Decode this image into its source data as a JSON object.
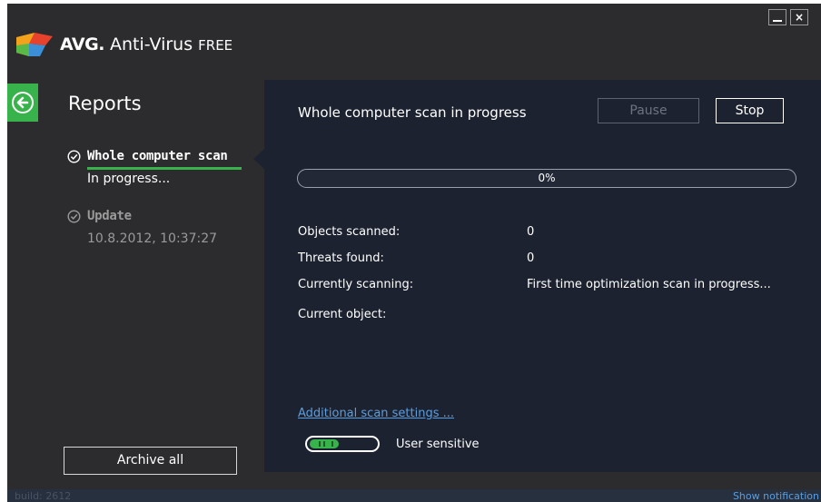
{
  "app": {
    "brand": "AVG.",
    "name": " Anti-Virus ",
    "edition": "FREE"
  },
  "window_controls": {
    "close_glyph": "×"
  },
  "sidebar": {
    "title": "Reports",
    "items": [
      {
        "title": "Whole computer scan",
        "subtitle": "In progress...",
        "icon": "check-circle-icon",
        "selected": true
      },
      {
        "title": "Update",
        "subtitle": "10.8.2012, 10:37:27",
        "icon": "check-circle-icon",
        "selected": false
      }
    ],
    "archive_label": "Archive all"
  },
  "main": {
    "title": "Whole computer scan in progress",
    "pause_label": "Pause",
    "stop_label": "Stop",
    "progress": {
      "value": 0,
      "label": "0%"
    },
    "stats": [
      {
        "label": "Objects scanned:",
        "value": "0"
      },
      {
        "label": "Threats found:",
        "value": "0"
      },
      {
        "label": "Currently scanning:",
        "value": "First time optimization scan in progress..."
      },
      {
        "label": "Current object:",
        "value": ""
      }
    ],
    "settings_link": "Additional scan settings ...",
    "toggle_label": "User sensitive"
  },
  "statusbar": {
    "build": "build: 2612",
    "notification_link": "Show notification"
  },
  "colors": {
    "accent_green": "#38b24a",
    "panel_dark": "#1d2230",
    "window_bg": "#2c2c2e",
    "link_blue": "#5b9ee0"
  }
}
